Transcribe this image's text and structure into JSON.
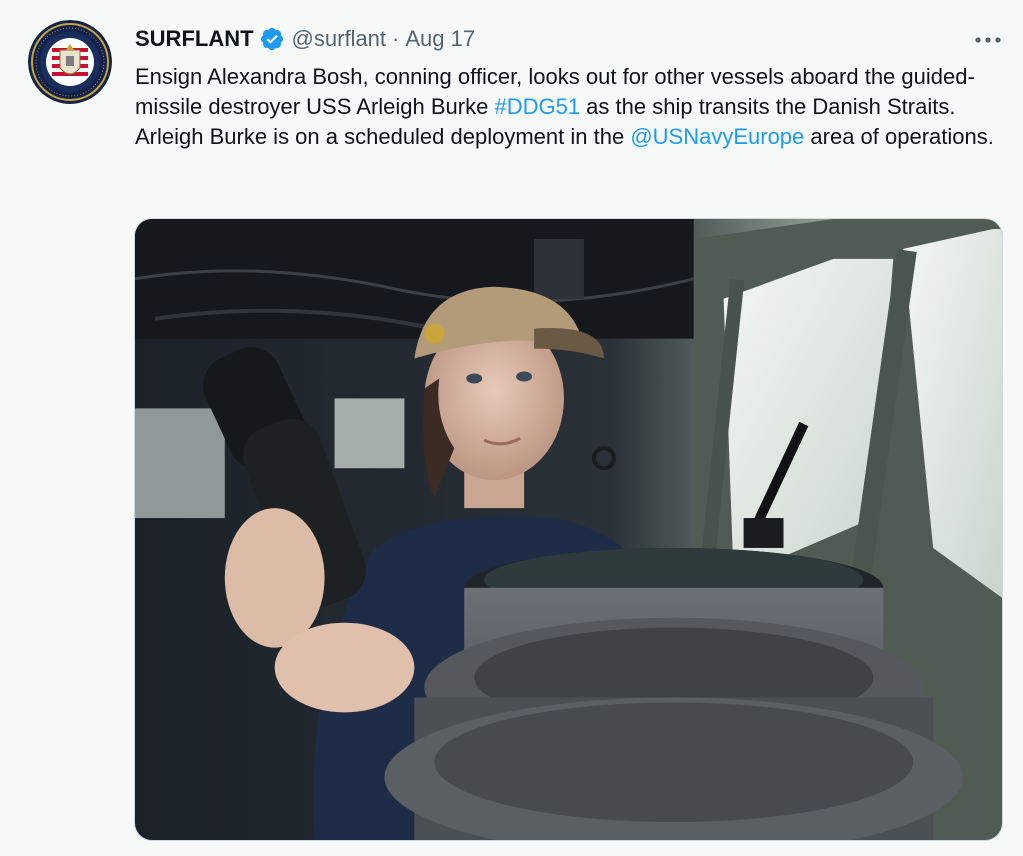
{
  "tweet": {
    "author_name": "SURFLANT",
    "handle": "@surflant",
    "separator": "·",
    "date": "Aug 17",
    "text_1": "Ensign Alexandra Bosh, conning officer, looks out for other vessels aboard the guided-missile destroyer USS Arleigh Burke ",
    "hashtag": "#DDG51",
    "text_2": " as the ship transits the Danish Straits. Arleigh Burke is on a scheduled deployment in the ",
    "mention": "@USNavyEurope",
    "text_3": " area of operations."
  },
  "icons": {
    "avatar": "surflant-seal-icon",
    "verified": "verified-badge-icon",
    "more": "more-options-icon"
  },
  "colors": {
    "link": "#1d9bf0",
    "verified": "#1d9bf0",
    "secondary_text": "#536471",
    "background": "#f7f9f9"
  },
  "media": {
    "type": "photo",
    "subject": "sailor in a ball cap holding binoculars next to a ship's gyrocompass on a destroyer bridge"
  }
}
